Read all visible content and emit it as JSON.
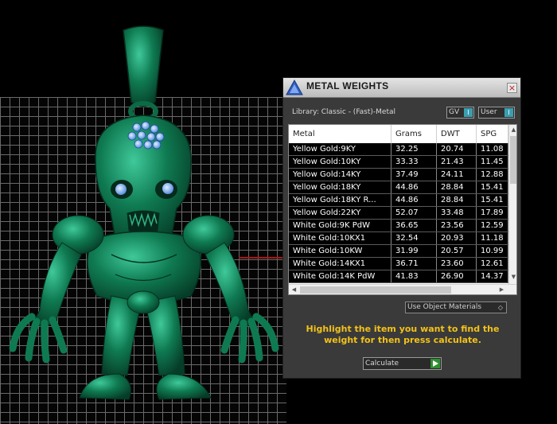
{
  "dialog": {
    "title": "METAL WEIGHTS",
    "close_glyph": "×",
    "library_label": "Library: Classic - (Fast)-Metal",
    "toggles": [
      {
        "label": "GV",
        "knob": "I"
      },
      {
        "label": "User",
        "knob": "I"
      }
    ],
    "table": {
      "columns": [
        "Metal",
        "Grams",
        "DWT",
        "SPG"
      ],
      "rows": [
        [
          "Yellow Gold:9KY",
          "32.25",
          "20.74",
          "11.08"
        ],
        [
          "Yellow Gold:10KY",
          "33.33",
          "21.43",
          "11.45"
        ],
        [
          "Yellow Gold:14KY",
          "37.49",
          "24.11",
          "12.88"
        ],
        [
          "Yellow Gold:18KY",
          "44.86",
          "28.84",
          "15.41"
        ],
        [
          "Yellow Gold:18KY R...",
          "44.86",
          "28.84",
          "15.41"
        ],
        [
          "Yellow Gold:22KY",
          "52.07",
          "33.48",
          "17.89"
        ],
        [
          "White Gold:9K PdW",
          "36.65",
          "23.56",
          "12.59"
        ],
        [
          "White Gold:10KX1",
          "32.54",
          "20.93",
          "11.18"
        ],
        [
          "White Gold:10KW",
          "31.99",
          "20.57",
          "10.99"
        ],
        [
          "White Gold:14KX1",
          "36.71",
          "23.60",
          "12.61"
        ],
        [
          "White Gold:14K PdW",
          "41.83",
          "26.90",
          "14.37"
        ]
      ]
    },
    "materials_select": "Use Object Materials",
    "hint": "Highlight the item you want to find the weight for then press calculate.",
    "calculate_label": "Calculate"
  },
  "colors": {
    "model": "#0f7a52",
    "gems": "#7fb6ff",
    "hint": "#f2c21a",
    "accent": "#3a9fb0",
    "axis_red": "#b01515"
  },
  "icons": [
    "app-logo-icon",
    "close-icon",
    "chevron-down-icon",
    "play-arrow-icon",
    "scroll-up-icon",
    "scroll-down-icon",
    "scroll-left-icon",
    "scroll-right-icon"
  ]
}
